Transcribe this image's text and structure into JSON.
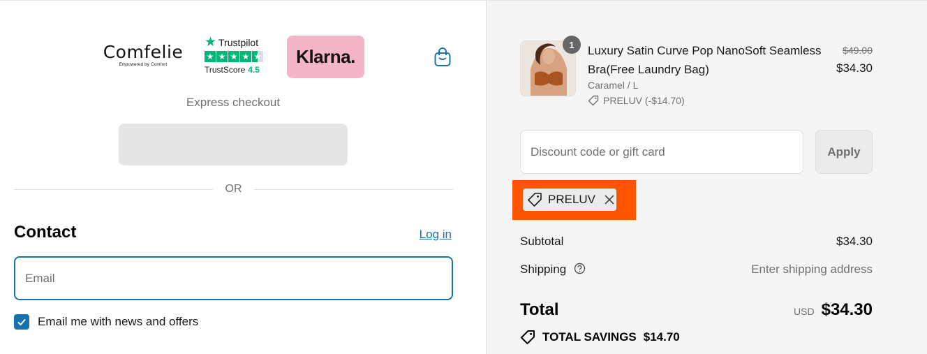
{
  "header": {
    "brand": {
      "name": "Comfelie",
      "tagline": "Empowered by Comfort"
    },
    "trustpilot": {
      "name": "Trustpilot",
      "score_label": "TrustScore",
      "score": "4.5"
    },
    "klarna": {
      "label": "Klarna."
    },
    "cart_icon": "shopping-bag-icon"
  },
  "express": {
    "label": "Express checkout",
    "or": "OR"
  },
  "contact": {
    "title": "Contact",
    "login_link": "Log in",
    "email_placeholder": "Email",
    "email_value": "",
    "newsletter_label": "Email me with news and offers",
    "newsletter_checked": true
  },
  "order": {
    "item": {
      "quantity": "1",
      "title": "Luxury Satin Curve Pop NanoSoft Seamless Bra(Free Laundry Bag)",
      "variant": "Caramel / L",
      "discount": "PRELUV (-$14.70)",
      "original_price": "$49.00",
      "price": "$34.30"
    },
    "discount_placeholder": "Discount code or gift card",
    "apply_label": "Apply",
    "applied_code": "PRELUV",
    "subtotal_label": "Subtotal",
    "subtotal_value": "$34.30",
    "shipping_label": "Shipping",
    "shipping_value": "Enter shipping address",
    "total_label": "Total",
    "currency": "USD",
    "total_value": "$34.30",
    "savings_label": "TOTAL SAVINGS",
    "savings_value": "$14.70"
  },
  "colors": {
    "accent": "#1773b0",
    "trustpilot_green": "#00b67a",
    "klarna_pink": "#f4b6c7",
    "highlight": "#ff5500",
    "summary_bg": "#f5f5f5"
  }
}
